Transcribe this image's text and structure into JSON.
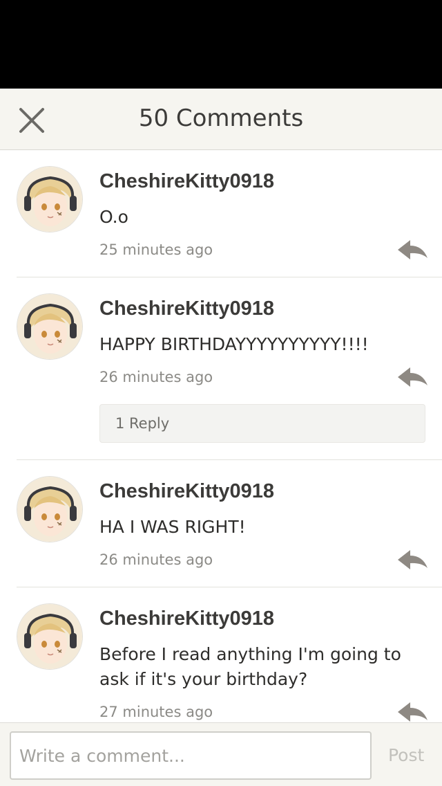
{
  "header": {
    "title": "50 Comments"
  },
  "comments": [
    {
      "author": "CheshireKitty0918",
      "text": "O.o",
      "time": "25 minutes ago"
    },
    {
      "author": "CheshireKitty0918",
      "text": "HAPPY BIRTHDAYYYYYYYYYY!!!!",
      "time": "26 minutes ago",
      "replies_label": "1 Reply"
    },
    {
      "author": "CheshireKitty0918",
      "text": "HA I WAS RIGHT!",
      "time": "26 minutes ago"
    },
    {
      "author": "CheshireKitty0918",
      "text": "Before I read anything I'm going to ask if it's your birthday?",
      "time": "27 minutes ago"
    }
  ],
  "composer": {
    "placeholder": "Write a comment...",
    "post_label": "Post"
  },
  "colors": {
    "header_bg": "#f6f5f0",
    "text": "#3c3b39",
    "muted": "#8b8a86",
    "reply_icon": "#8e8983"
  }
}
